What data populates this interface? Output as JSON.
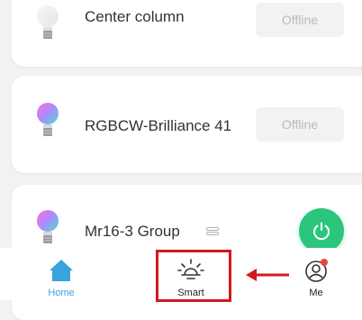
{
  "devices": [
    {
      "name": "Center column",
      "status": "Offline"
    },
    {
      "name": "RGBCW-Brilliance 41",
      "status": "Offline"
    },
    {
      "name": "Mr16-3 Group"
    }
  ],
  "tabs": [
    {
      "label": "Home",
      "icon": "home-icon"
    },
    {
      "label": "Smart",
      "icon": "sun-icon"
    },
    {
      "label": "Me",
      "icon": "profile-icon"
    }
  ],
  "colors": {
    "accent_green": "#2bc67b",
    "home_blue": "#3ba3dc",
    "offline_text": "#b9b9bd",
    "notification_red": "#e8473a",
    "annotation_red": "#d4181e"
  }
}
